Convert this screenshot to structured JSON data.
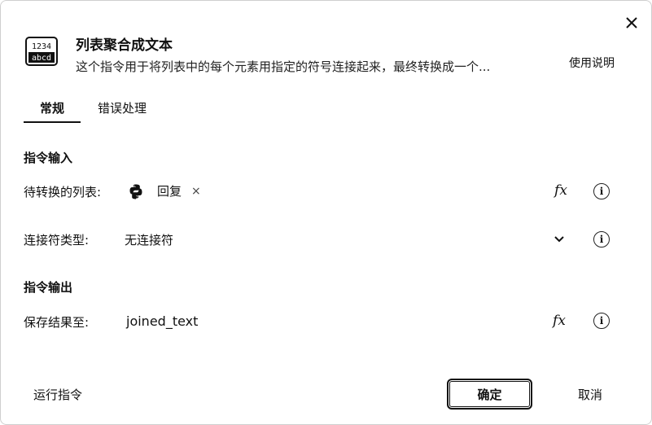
{
  "dialog": {
    "title": "列表聚合成文本",
    "description": "这个指令用于将列表中的每个元素用指定的符号连接起来，最终转换成一个...",
    "help_link": "使用说明",
    "icon_text_top": "1234",
    "icon_text_bottom": "abcd"
  },
  "tabs": [
    {
      "label": "常规",
      "active": true
    },
    {
      "label": "错误处理",
      "active": false
    }
  ],
  "input_section": {
    "title": "指令输入",
    "list_field": {
      "label": "待转换的列表:",
      "value": "回复",
      "remove_glyph": "×"
    },
    "separator_field": {
      "label": "连接符类型:",
      "value": "无连接符"
    }
  },
  "output_section": {
    "title": "指令输出",
    "save_field": {
      "label": "保存结果至:",
      "value": "joined_text"
    }
  },
  "footer": {
    "run_label": "运行指令",
    "ok_label": "确定",
    "cancel_label": "取消"
  },
  "fx_label": "fx",
  "info_glyph": "i"
}
